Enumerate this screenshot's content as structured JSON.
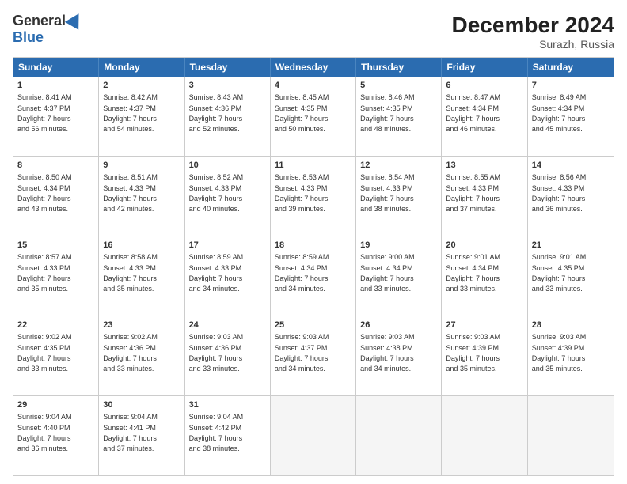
{
  "header": {
    "logo_general": "General",
    "logo_blue": "Blue",
    "month_title": "December 2024",
    "location": "Surazh, Russia"
  },
  "days_of_week": [
    "Sunday",
    "Monday",
    "Tuesday",
    "Wednesday",
    "Thursday",
    "Friday",
    "Saturday"
  ],
  "weeks": [
    [
      {
        "day": "1",
        "info": "Sunrise: 8:41 AM\nSunset: 4:37 PM\nDaylight: 7 hours\nand 56 minutes."
      },
      {
        "day": "2",
        "info": "Sunrise: 8:42 AM\nSunset: 4:37 PM\nDaylight: 7 hours\nand 54 minutes."
      },
      {
        "day": "3",
        "info": "Sunrise: 8:43 AM\nSunset: 4:36 PM\nDaylight: 7 hours\nand 52 minutes."
      },
      {
        "day": "4",
        "info": "Sunrise: 8:45 AM\nSunset: 4:35 PM\nDaylight: 7 hours\nand 50 minutes."
      },
      {
        "day": "5",
        "info": "Sunrise: 8:46 AM\nSunset: 4:35 PM\nDaylight: 7 hours\nand 48 minutes."
      },
      {
        "day": "6",
        "info": "Sunrise: 8:47 AM\nSunset: 4:34 PM\nDaylight: 7 hours\nand 46 minutes."
      },
      {
        "day": "7",
        "info": "Sunrise: 8:49 AM\nSunset: 4:34 PM\nDaylight: 7 hours\nand 45 minutes."
      }
    ],
    [
      {
        "day": "8",
        "info": "Sunrise: 8:50 AM\nSunset: 4:34 PM\nDaylight: 7 hours\nand 43 minutes."
      },
      {
        "day": "9",
        "info": "Sunrise: 8:51 AM\nSunset: 4:33 PM\nDaylight: 7 hours\nand 42 minutes."
      },
      {
        "day": "10",
        "info": "Sunrise: 8:52 AM\nSunset: 4:33 PM\nDaylight: 7 hours\nand 40 minutes."
      },
      {
        "day": "11",
        "info": "Sunrise: 8:53 AM\nSunset: 4:33 PM\nDaylight: 7 hours\nand 39 minutes."
      },
      {
        "day": "12",
        "info": "Sunrise: 8:54 AM\nSunset: 4:33 PM\nDaylight: 7 hours\nand 38 minutes."
      },
      {
        "day": "13",
        "info": "Sunrise: 8:55 AM\nSunset: 4:33 PM\nDaylight: 7 hours\nand 37 minutes."
      },
      {
        "day": "14",
        "info": "Sunrise: 8:56 AM\nSunset: 4:33 PM\nDaylight: 7 hours\nand 36 minutes."
      }
    ],
    [
      {
        "day": "15",
        "info": "Sunrise: 8:57 AM\nSunset: 4:33 PM\nDaylight: 7 hours\nand 35 minutes."
      },
      {
        "day": "16",
        "info": "Sunrise: 8:58 AM\nSunset: 4:33 PM\nDaylight: 7 hours\nand 35 minutes."
      },
      {
        "day": "17",
        "info": "Sunrise: 8:59 AM\nSunset: 4:33 PM\nDaylight: 7 hours\nand 34 minutes."
      },
      {
        "day": "18",
        "info": "Sunrise: 8:59 AM\nSunset: 4:34 PM\nDaylight: 7 hours\nand 34 minutes."
      },
      {
        "day": "19",
        "info": "Sunrise: 9:00 AM\nSunset: 4:34 PM\nDaylight: 7 hours\nand 33 minutes."
      },
      {
        "day": "20",
        "info": "Sunrise: 9:01 AM\nSunset: 4:34 PM\nDaylight: 7 hours\nand 33 minutes."
      },
      {
        "day": "21",
        "info": "Sunrise: 9:01 AM\nSunset: 4:35 PM\nDaylight: 7 hours\nand 33 minutes."
      }
    ],
    [
      {
        "day": "22",
        "info": "Sunrise: 9:02 AM\nSunset: 4:35 PM\nDaylight: 7 hours\nand 33 minutes."
      },
      {
        "day": "23",
        "info": "Sunrise: 9:02 AM\nSunset: 4:36 PM\nDaylight: 7 hours\nand 33 minutes."
      },
      {
        "day": "24",
        "info": "Sunrise: 9:03 AM\nSunset: 4:36 PM\nDaylight: 7 hours\nand 33 minutes."
      },
      {
        "day": "25",
        "info": "Sunrise: 9:03 AM\nSunset: 4:37 PM\nDaylight: 7 hours\nand 34 minutes."
      },
      {
        "day": "26",
        "info": "Sunrise: 9:03 AM\nSunset: 4:38 PM\nDaylight: 7 hours\nand 34 minutes."
      },
      {
        "day": "27",
        "info": "Sunrise: 9:03 AM\nSunset: 4:39 PM\nDaylight: 7 hours\nand 35 minutes."
      },
      {
        "day": "28",
        "info": "Sunrise: 9:03 AM\nSunset: 4:39 PM\nDaylight: 7 hours\nand 35 minutes."
      }
    ],
    [
      {
        "day": "29",
        "info": "Sunrise: 9:04 AM\nSunset: 4:40 PM\nDaylight: 7 hours\nand 36 minutes."
      },
      {
        "day": "30",
        "info": "Sunrise: 9:04 AM\nSunset: 4:41 PM\nDaylight: 7 hours\nand 37 minutes."
      },
      {
        "day": "31",
        "info": "Sunrise: 9:04 AM\nSunset: 4:42 PM\nDaylight: 7 hours\nand 38 minutes."
      },
      {
        "day": "",
        "info": ""
      },
      {
        "day": "",
        "info": ""
      },
      {
        "day": "",
        "info": ""
      },
      {
        "day": "",
        "info": ""
      }
    ]
  ]
}
